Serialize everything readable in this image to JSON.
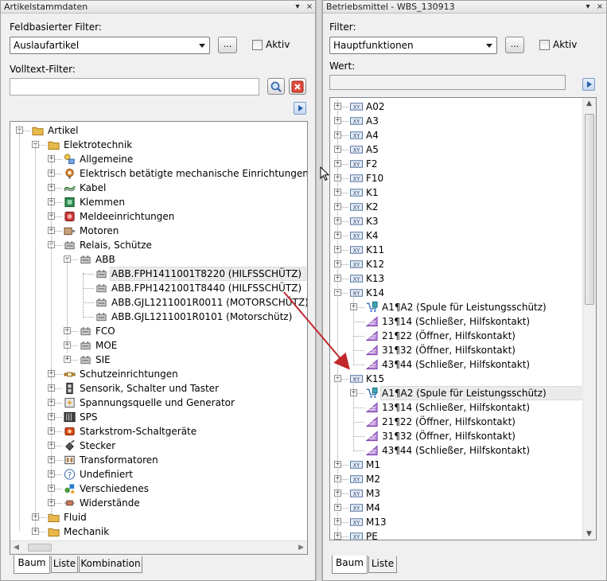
{
  "left": {
    "title": "Artikelstammdaten",
    "pin": "▾",
    "close": "×",
    "field_filter_label": "Feldbasierter Filter:",
    "field_filter_value": "Auslaufartikel",
    "more_label": "...",
    "aktiv_label": "Aktiv",
    "fulltext_label": "Volltext-Filter:",
    "fulltext_value": "",
    "tree": [
      {
        "label": "Artikel",
        "level": 0,
        "expander": "-",
        "icon": "folder"
      },
      {
        "label": "Elektrotechnik",
        "level": 1,
        "expander": "-",
        "icon": "folder"
      },
      {
        "label": "Allgemeine",
        "level": 2,
        "expander": "+",
        "icon": "shapes"
      },
      {
        "label": "Elektrisch betätigte mechanische Einrichtungen",
        "level": 2,
        "expander": "+",
        "icon": "actuator"
      },
      {
        "label": "Kabel",
        "level": 2,
        "expander": "+",
        "icon": "cable"
      },
      {
        "label": "Klemmen",
        "level": 2,
        "expander": "+",
        "icon": "terminal"
      },
      {
        "label": "Meldeeinrichtungen",
        "level": 2,
        "expander": "+",
        "icon": "signal"
      },
      {
        "label": "Motoren",
        "level": 2,
        "expander": "+",
        "icon": "motor"
      },
      {
        "label": "Relais, Schütze",
        "level": 2,
        "expander": "-",
        "icon": "relay"
      },
      {
        "label": "ABB",
        "level": 3,
        "expander": "-",
        "icon": "relay"
      },
      {
        "label": "ABB.FPH1411001T8220 (HILFSSCHÜTZ)",
        "level": 4,
        "expander": "",
        "icon": "relay",
        "selected": true
      },
      {
        "label": "ABB.FPH1421001T8440 (HILFSSCHÜTZ)",
        "level": 4,
        "expander": "",
        "icon": "relay"
      },
      {
        "label": "ABB.GJL1211001R0011 (MOTORSCHÜTZ)",
        "level": 4,
        "expander": "",
        "icon": "relay"
      },
      {
        "label": "ABB.GJL1211001R0101 (Motorschütz)",
        "level": 4,
        "expander": "",
        "icon": "relay"
      },
      {
        "label": "FCO",
        "level": 3,
        "expander": "+",
        "icon": "relay"
      },
      {
        "label": "MOE",
        "level": 3,
        "expander": "+",
        "icon": "relay"
      },
      {
        "label": "SIE",
        "level": 3,
        "expander": "+",
        "icon": "relay"
      },
      {
        "label": "Schutzeinrichtungen",
        "level": 2,
        "expander": "+",
        "icon": "fuse"
      },
      {
        "label": "Sensorik, Schalter und Taster",
        "level": 2,
        "expander": "+",
        "icon": "switch"
      },
      {
        "label": "Spannungsquelle und Generator",
        "level": 2,
        "expander": "+",
        "icon": "generator"
      },
      {
        "label": "SPS",
        "level": 2,
        "expander": "+",
        "icon": "plc"
      },
      {
        "label": "Starkstrom-Schaltgeräte",
        "level": 2,
        "expander": "+",
        "icon": "power"
      },
      {
        "label": "Stecker",
        "level": 2,
        "expander": "+",
        "icon": "plug"
      },
      {
        "label": "Transformatoren",
        "level": 2,
        "expander": "+",
        "icon": "transformer"
      },
      {
        "label": "Undefiniert",
        "level": 2,
        "expander": "+",
        "icon": "question"
      },
      {
        "label": "Verschiedenes",
        "level": 2,
        "expander": "+",
        "icon": "misc"
      },
      {
        "label": "Widerstände",
        "level": 2,
        "expander": "+",
        "icon": "resistor"
      },
      {
        "label": "Fluid",
        "level": 1,
        "expander": "+",
        "icon": "folder"
      },
      {
        "label": "Mechanik",
        "level": 1,
        "expander": "+",
        "icon": "folder"
      }
    ],
    "tabs": [
      "Baum",
      "Liste",
      "Kombination"
    ]
  },
  "right": {
    "title": "Betriebsmittel - WBS_130913",
    "pin": "▾",
    "close": "×",
    "filter_label": "Filter:",
    "filter_value": "Hauptfunktionen",
    "more_label": "...",
    "aktiv_label": "Aktiv",
    "wert_label": "Wert:",
    "wert_value": "",
    "tree": [
      {
        "label": "A02",
        "level": 0,
        "expander": "+",
        "icon": "device"
      },
      {
        "label": "A3",
        "level": 0,
        "expander": "+",
        "icon": "device"
      },
      {
        "label": "A4",
        "level": 0,
        "expander": "+",
        "icon": "device"
      },
      {
        "label": "A5",
        "level": 0,
        "expander": "+",
        "icon": "device"
      },
      {
        "label": "F2",
        "level": 0,
        "expander": "+",
        "icon": "device"
      },
      {
        "label": "F10",
        "level": 0,
        "expander": "+",
        "icon": "device"
      },
      {
        "label": "K1",
        "level": 0,
        "expander": "+",
        "icon": "device"
      },
      {
        "label": "K2",
        "level": 0,
        "expander": "+",
        "icon": "device"
      },
      {
        "label": "K3",
        "level": 0,
        "expander": "+",
        "icon": "device"
      },
      {
        "label": "K4",
        "level": 0,
        "expander": "+",
        "icon": "device"
      },
      {
        "label": "K11",
        "level": 0,
        "expander": "+",
        "icon": "device"
      },
      {
        "label": "K12",
        "level": 0,
        "expander": "+",
        "icon": "device"
      },
      {
        "label": "K13",
        "level": 0,
        "expander": "+",
        "icon": "device"
      },
      {
        "label": "K14",
        "level": 0,
        "expander": "-",
        "icon": "device"
      },
      {
        "label": "A1¶A2 (Spule für Leistungsschütz)",
        "level": 1,
        "expander": "+",
        "icon": "coil"
      },
      {
        "label": "13¶14 (Schließer, Hilfskontakt)",
        "level": 1,
        "expander": "",
        "icon": "contact"
      },
      {
        "label": "21¶22 (Öffner, Hilfskontakt)",
        "level": 1,
        "expander": "",
        "icon": "contact"
      },
      {
        "label": "31¶32 (Öffner, Hilfskontakt)",
        "level": 1,
        "expander": "",
        "icon": "contact"
      },
      {
        "label": "43¶44 (Schließer, Hilfskontakt)",
        "level": 1,
        "expander": "",
        "icon": "contact"
      },
      {
        "label": "K15",
        "level": 0,
        "expander": "-",
        "icon": "device"
      },
      {
        "label": "A1¶A2 (Spule für Leistungsschütz)",
        "level": 1,
        "expander": "+",
        "icon": "coil",
        "selected": true
      },
      {
        "label": "13¶14 (Schließer, Hilfskontakt)",
        "level": 1,
        "expander": "",
        "icon": "contact"
      },
      {
        "label": "21¶22 (Öffner, Hilfskontakt)",
        "level": 1,
        "expander": "",
        "icon": "contact"
      },
      {
        "label": "31¶32 (Öffner, Hilfskontakt)",
        "level": 1,
        "expander": "",
        "icon": "contact"
      },
      {
        "label": "43¶44 (Schließer, Hilfskontakt)",
        "level": 1,
        "expander": "",
        "icon": "contact"
      },
      {
        "label": "M1",
        "level": 0,
        "expander": "+",
        "icon": "device"
      },
      {
        "label": "M2",
        "level": 0,
        "expander": "+",
        "icon": "device"
      },
      {
        "label": "M3",
        "level": 0,
        "expander": "+",
        "icon": "device"
      },
      {
        "label": "M4",
        "level": 0,
        "expander": "+",
        "icon": "device"
      },
      {
        "label": "M13",
        "level": 0,
        "expander": "+",
        "icon": "device"
      },
      {
        "label": "PE",
        "level": 0,
        "expander": "+",
        "icon": "device"
      }
    ],
    "tabs": [
      "Baum",
      "Liste"
    ]
  },
  "colors": {
    "arrow": "#c0282c",
    "selection": "#ebebeb",
    "folder": "#e8b84a",
    "contact": "#7a3aa8"
  }
}
